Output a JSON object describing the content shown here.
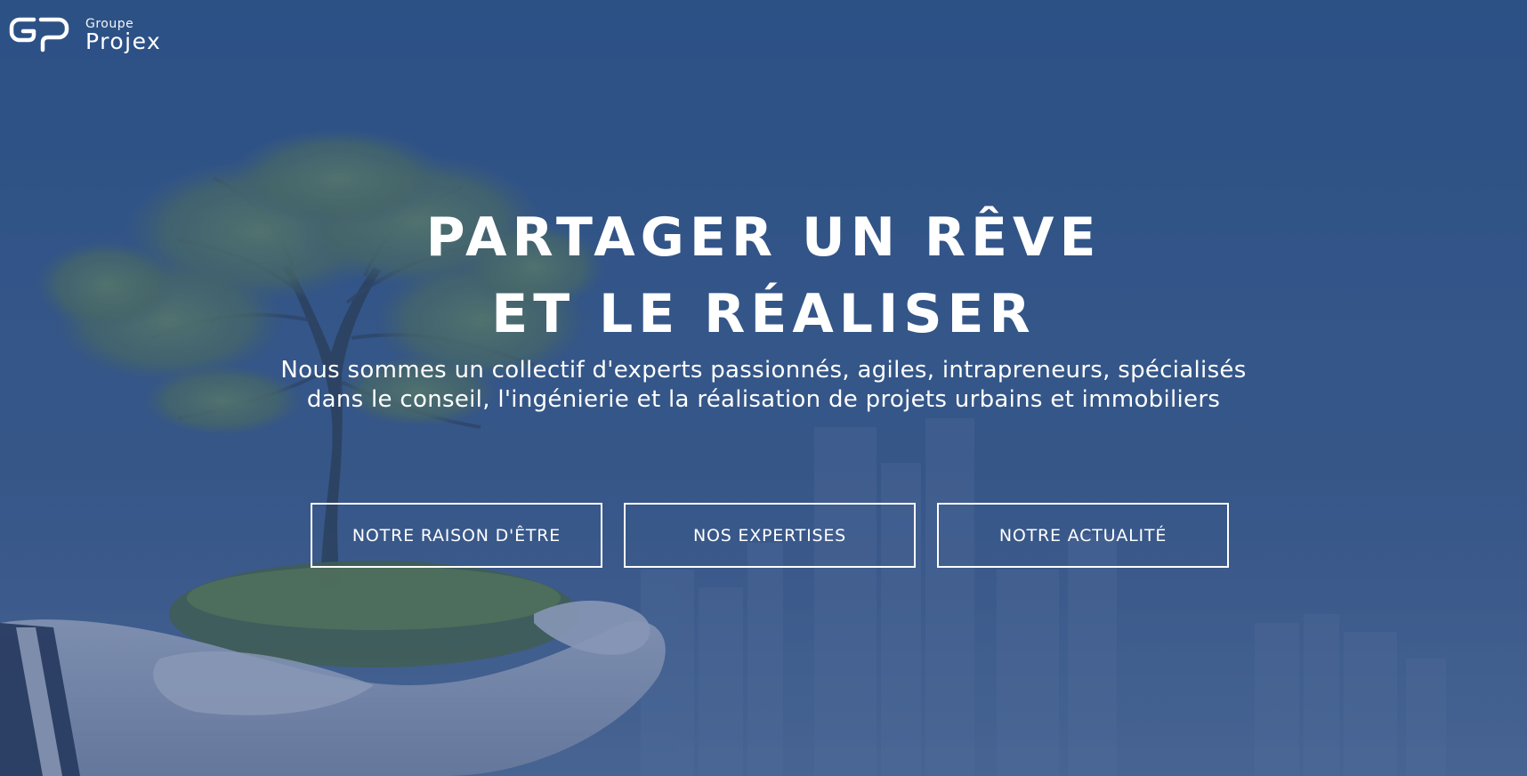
{
  "logo": {
    "mark": "GP",
    "small_text": "Groupe",
    "big_text": "Projex"
  },
  "hero": {
    "title_line1": "PARTAGER UN RÊVE",
    "title_line2": "ET LE RÉALISER",
    "subtitle": "Nous sommes un collectif d'experts passionnés, agiles, intrapreneurs, spécialisés dans le conseil, l'ingénierie et la réalisation de projets urbains et immobiliers"
  },
  "buttons": {
    "raison_label": "NOTRE RAISON D'ÊTRE",
    "expertises_label": "NOS EXPERTISES",
    "actualite_label": "NOTRE ACTUALITÉ"
  },
  "colors": {
    "overlay": "#3f5f8f",
    "text": "#ffffff"
  }
}
